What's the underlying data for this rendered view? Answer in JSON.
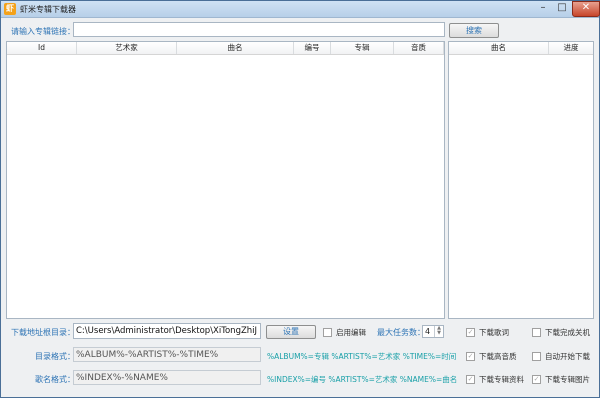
{
  "window": {
    "title": "虾米专辑下载器",
    "app_icon_text": "虾",
    "min": "–",
    "max": "□",
    "close": "✕"
  },
  "search": {
    "label": "请输入专辑链接：",
    "value": "",
    "button": "搜索"
  },
  "main_table": {
    "columns": [
      "Id",
      "艺术家",
      "曲名",
      "编号",
      "专辑",
      "音质"
    ]
  },
  "progress_table": {
    "columns": [
      "曲名",
      "进度"
    ]
  },
  "settings": {
    "download_dir_label": "下载地址根目录：",
    "download_dir_value": "C:\\Users\\Administrator\\Desktop\\XiTongZhiJ",
    "set_button": "设置",
    "enable_edit_label": "启用编辑",
    "max_tasks_label": "最大任务数：",
    "max_tasks_value": "4",
    "dir_format_label": "目录格式：",
    "dir_format_value": "%ALBUM%-%ARTIST%-%TIME%",
    "dir_format_hint": "%ALBUM%=专辑 %ARTIST%=艺术家 %TIME%=时间",
    "name_format_label": "歌名格式：",
    "name_format_value": "%INDEX%-%NAME%",
    "name_format_hint": "%INDEX%=编号 %ARTIST%=艺术家 %NAME%=曲名"
  },
  "options": {
    "download_lyrics": "下载歌词",
    "shutdown_after": "下载完成关机",
    "download_hq": "下载高音质",
    "auto_start": "自动开始下载",
    "download_album_info": "下载专辑资料",
    "download_album_cover": "下载专辑图片"
  }
}
